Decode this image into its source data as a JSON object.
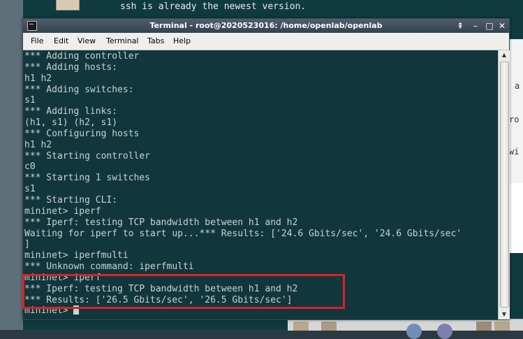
{
  "background": {
    "top_text_1": "ssh is already the newest version.",
    "top_text_2": "",
    "right_panel_chars": [
      "a",
      "ro",
      "wi"
    ]
  },
  "window": {
    "title": "Terminal - root@2020523016: /home/openlab/openlab",
    "buttons": {
      "sticky": "⇞",
      "minimize": "–",
      "maximize": "□",
      "close": "✕"
    }
  },
  "menubar": {
    "items": [
      {
        "label": "File"
      },
      {
        "label": "Edit"
      },
      {
        "label": "View"
      },
      {
        "label": "Terminal"
      },
      {
        "label": "Tabs"
      },
      {
        "label": "Help"
      }
    ]
  },
  "terminal": {
    "lines": [
      "*** Adding controller",
      "*** Adding hosts:",
      "h1 h2",
      "*** Adding switches:",
      "s1",
      "*** Adding links:",
      "(h1, s1) (h2, s1)",
      "*** Configuring hosts",
      "h1 h2",
      "*** Starting controller",
      "c0",
      "*** Starting 1 switches",
      "s1",
      "*** Starting CLI:",
      "mininet> iperf",
      "*** Iperf: testing TCP bandwidth between h1 and h2",
      "Waiting for iperf to start up...*** Results: ['24.6 Gbits/sec', '24.6 Gbits/sec'",
      "]",
      "mininet> iperfmulti",
      "*** Unknown command: iperfmulti",
      "mininet> iperf",
      "*** Iperf: testing TCP bandwidth between h1 and h2",
      "*** Results: ['26.5 Gbits/sec', '26.5 Gbits/sec']"
    ],
    "prompt": "mininet> "
  },
  "colors": {
    "terminal_bg": "#11363c",
    "terminal_fg": "#c8d4d6",
    "highlight": "#e02020"
  }
}
